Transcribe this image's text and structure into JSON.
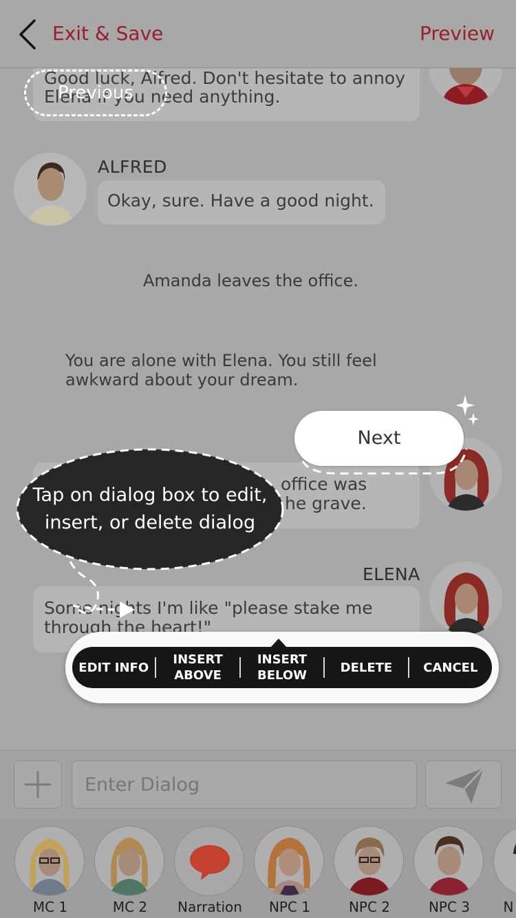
{
  "header": {
    "back_label": "Exit & Save",
    "preview_label": "Preview"
  },
  "chat": {
    "msg_top": "Good luck, Alfred. Don't hesitate to annoy Elena if you need anything.",
    "msg_top_line1": "Good luck, Alfred. Don't hesitate to annoy",
    "msg_top_line2": "Elena if you need anything.",
    "alfred_name": "ALFRED",
    "alfred_msg": "Okay, sure. Have a good night.",
    "narration_1": "Amanda leaves the office.",
    "narration_2_line1": "You are alone with Elena. You still feel",
    "narration_2_line2": "awkward about your dream.",
    "elena_msg_partial_line1": "office was",
    "elena_msg_partial_line2": "he grave.",
    "elena_name": "ELENA",
    "elena_msg_line1": "Some nights I'm like \"please stake me",
    "elena_msg_line2": "through the heart!\""
  },
  "tutorial": {
    "previous_label": "Previous",
    "next_label": "Next",
    "tip_line1": "Tap on dialog box to edit,",
    "tip_line2": "insert, or delete dialog"
  },
  "context_menu": {
    "edit_info": "EDIT INFO",
    "insert_above_1": "INSERT",
    "insert_above_2": "ABOVE",
    "insert_below_1": "INSERT",
    "insert_below_2": "BELOW",
    "delete": "DELETE",
    "cancel": "CANCEL"
  },
  "input": {
    "placeholder": "Enter Dialog"
  },
  "characters": [
    {
      "name": "MC 1"
    },
    {
      "name": "MC 2"
    },
    {
      "name": "Narration"
    },
    {
      "name": "NPC 1"
    },
    {
      "name": "NPC 2"
    },
    {
      "name": "NPC 3"
    },
    {
      "name": "N"
    }
  ],
  "colors": {
    "accent": "#9a1f2e",
    "narration_icon": "#c4412f",
    "menu_bg": "#161616"
  }
}
